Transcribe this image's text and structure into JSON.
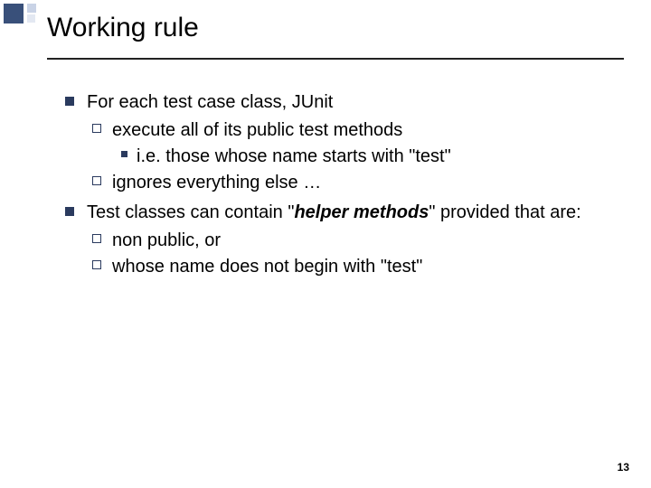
{
  "title": "Working rule",
  "bullets": {
    "b1": "For each test case class, JUnit",
    "b1a": "execute all of its public test methods",
    "b1a_i_pre": "i.e. those whose name starts with ",
    "b1a_i_quote": "\"test\"",
    "b1b": "ignores everything else …",
    "b2_pre": "Test classes can contain \"",
    "b2_em": "helper methods",
    "b2_post": "\" provided that are:",
    "b2a": "non public, or",
    "b2b": "whose name does not begin with \"test\""
  },
  "page_number": "13"
}
